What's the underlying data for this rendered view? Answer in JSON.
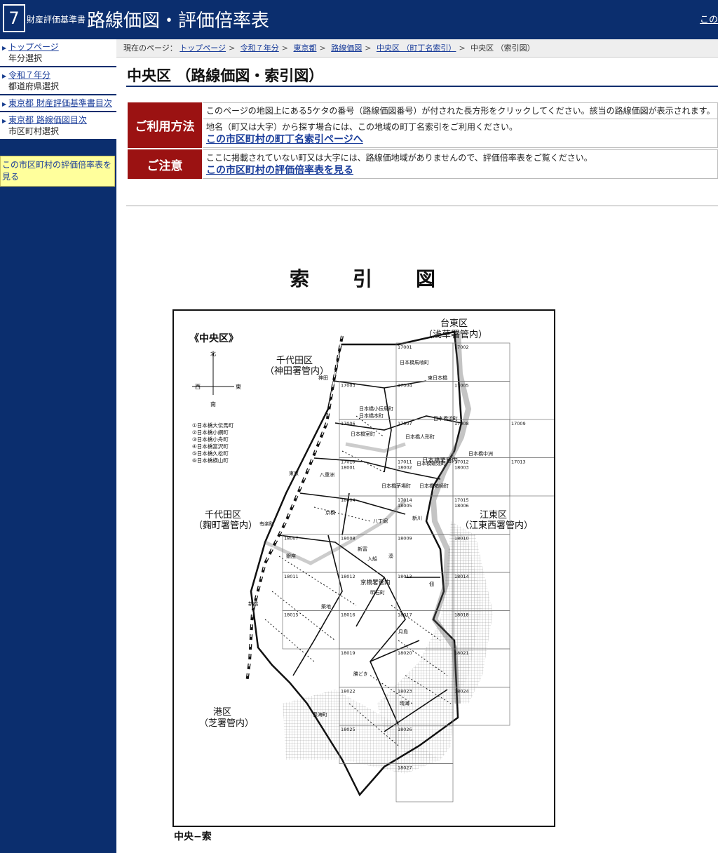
{
  "header": {
    "logo_number": "7",
    "subtitle": "財産評価基準書",
    "title": "路線価図・評価倍率表",
    "right_link": "この"
  },
  "sidebar": {
    "items": [
      {
        "link": "トップページ",
        "sub": "年分選択"
      },
      {
        "link": "令和７年分",
        "sub": "都道府県選択"
      },
      {
        "link": "東京都 財産評価基準書目次",
        "sub": ""
      },
      {
        "link": "東京都 路線価図目次",
        "sub": "市区町村選択"
      }
    ],
    "note": "この市区町村の評価倍率表を見る"
  },
  "breadcrumb": {
    "prefix": "現在のページ：",
    "links": [
      "トップページ",
      "令和７年分",
      "東京都",
      "路線価図",
      "中央区 （町丁名索引）"
    ],
    "current": "中央区 （索引図）"
  },
  "page": {
    "title": "中央区 （路線価図・索引図）"
  },
  "usage": {
    "heading": "ご利用方法",
    "line1": "このページの地図上にある5ケタの番号（路線価図番号）が付された長方形をクリックしてください。該当の路線価図が表示されます。",
    "line2": "地名（町又は大字）から探す場合には、この地域の町丁名索引をご利用ください。",
    "link": "この市区町村の町丁名索引ページへ"
  },
  "caution": {
    "heading": "ご注意",
    "line1": "ここに掲載されていない町又は大字には、路線価地域がありませんので、評価倍率表をご覧ください。",
    "link": "この市区町村の評価倍率表を見る"
  },
  "map": {
    "heading": "索引図",
    "ward": "《中央区》",
    "compass": {
      "n": "北",
      "s": "南",
      "e": "東",
      "w": "西"
    },
    "legend": [
      "①日本橋大伝馬町",
      "②日本橋小網町",
      "③日本橋小舟町",
      "④日本橋富沢町",
      "⑤日本橋久松町",
      "⑥日本橋横山町"
    ],
    "regions": [
      {
        "name": "台東区",
        "sub": "（浅草署管内）"
      },
      {
        "name": "千代田区",
        "sub": "（神田署管内）"
      },
      {
        "name": "千代田区",
        "sub": "（麹町署管内）"
      },
      {
        "name": "江東区",
        "sub": "（江東西署管内）"
      },
      {
        "name": "港区",
        "sub": "（芝署管内）"
      }
    ],
    "sheets": [
      "17001",
      "17002",
      "17003",
      "17004",
      "17005",
      "17006",
      "17007",
      "17008",
      "17009",
      "17010",
      "18001",
      "17011",
      "18002",
      "17012",
      "18003",
      "17013",
      "18004",
      "17014",
      "18005",
      "17015",
      "18006",
      "18007",
      "18008",
      "18009",
      "18010",
      "18011",
      "18012",
      "18013",
      "18014",
      "18015",
      "18016",
      "18017",
      "18018",
      "18019",
      "18020",
      "18021",
      "18022",
      "18023",
      "18024",
      "18025",
      "18026",
      "18027"
    ],
    "places": [
      "日本橋馬喰町",
      "東日本橋",
      "日本橋小伝馬町",
      "日本橋本町",
      "日本橋室町",
      "日本橋人形町",
      "日本橋浜町",
      "日本橋中洲",
      "日本橋蛎殻町",
      "日本橋箱崎町",
      "日本橋茅場町",
      "八重洲",
      "京橋",
      "八丁堀",
      "新川",
      "銀座",
      "新富",
      "入船",
      "湊",
      "築地",
      "明石町",
      "佃",
      "月島",
      "勝どき",
      "晴海",
      "豊海町",
      "東京",
      "神田",
      "有楽町",
      "新橋"
    ],
    "stations": [
      "日本橋署管内",
      "京橋署管内"
    ],
    "caption": "中央−索"
  }
}
